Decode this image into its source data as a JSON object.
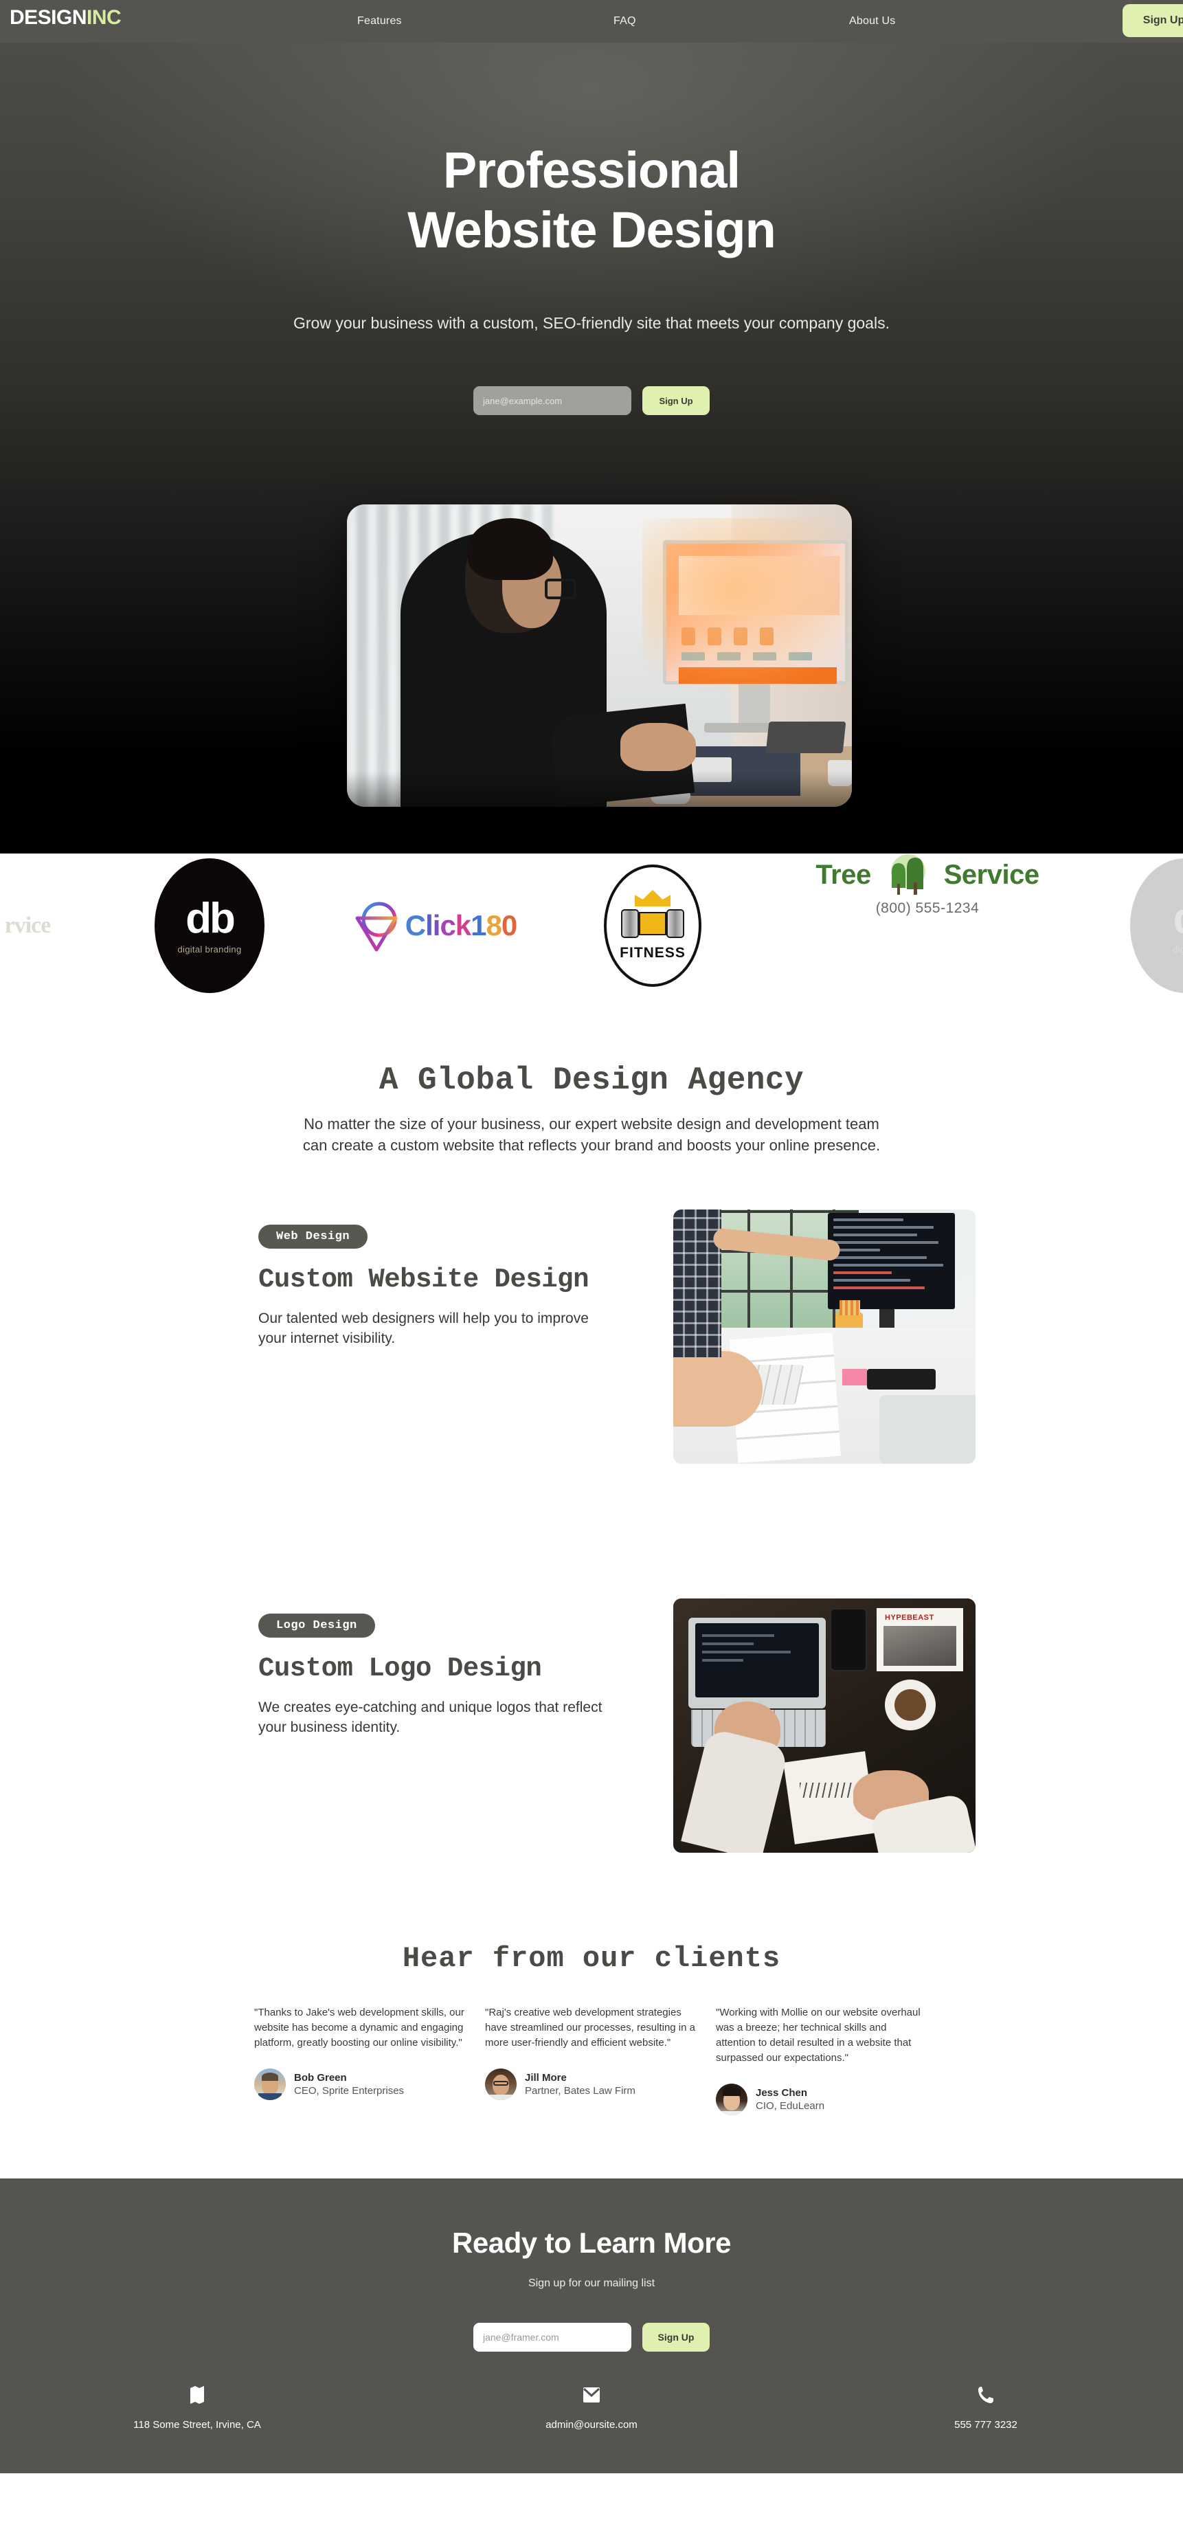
{
  "nav": {
    "logo_dark_text": "DESIGN",
    "logo_accent_text": "INC",
    "links": [
      {
        "label": "Features"
      },
      {
        "label": "FAQ"
      },
      {
        "label": "About Us"
      }
    ],
    "cta_label": "Sign Up",
    "accent_color": "#dff0b0",
    "bar_color": "#565450"
  },
  "hero": {
    "heading_line1": "Professional",
    "heading_line2": "Website Design",
    "subheading": "Grow your business with a custom, SEO-friendly site that meets your company goals.",
    "email_placeholder": "jane@example.com",
    "email_value": "",
    "cta_label": "Sign Up",
    "image_alt": "man-at-desk-using-computer-photo"
  },
  "logo_strip": {
    "items": [
      {
        "name": "partial-left-service-logo",
        "text": "rvice"
      },
      {
        "name": "db-digital-branding-logo",
        "main": "db",
        "sub": "digital branding"
      },
      {
        "name": "click180-logo",
        "word_parts": [
          {
            "t": "C",
            "c": "#4b7fd4"
          },
          {
            "t": "l",
            "c": "#5a5fc7"
          },
          {
            "t": "i",
            "c": "#7b4fc0"
          },
          {
            "t": "c",
            "c": "#a544b4"
          },
          {
            "t": "k",
            "c": "#d0408f"
          },
          {
            "t": "1",
            "c": "#3f74d0"
          },
          {
            "t": "8",
            "c": "#e8a33d"
          },
          {
            "t": "0",
            "c": "#e2643d"
          }
        ]
      },
      {
        "name": "fitness-logo",
        "word": "FITNESS"
      },
      {
        "name": "tree-service-logo",
        "word1": "Tree",
        "word2": "Service",
        "phone": "(800) 555-1234"
      },
      {
        "name": "partial-right-db-logo",
        "main": "d",
        "sub": "digital"
      }
    ]
  },
  "agency": {
    "heading": "A Global Design Agency",
    "body": "No matter the size of your business, our expert website design and development team can create a custom website that reflects your brand and boosts your online presence."
  },
  "features": [
    {
      "chip": "Web Design",
      "title": "Custom Website Design",
      "body": "Our talented web designers will help you to improve your internet visibility.",
      "image_alt": "designers-pointing-at-code-on-monitor-photo"
    },
    {
      "chip": "Logo Design",
      "title": "Custom Logo Design",
      "body": "We creates eye-catching and unique logos that reflect your business identity.",
      "image_alt": "overhead-desk-with-laptop-and-coffee-photo"
    }
  ],
  "testimonials": {
    "heading": "Hear from our clients",
    "cards": [
      {
        "quote": "\"Thanks to Jake's web development skills, our website has become a dynamic and engaging platform, greatly boosting our online visibility.\"",
        "name": "Bob Green",
        "role": "CEO, Sprite Enterprises",
        "avatar": "man-portrait-avatar"
      },
      {
        "quote": "\"Raj's creative web development strategies have streamlined our processes, resulting in a more user-friendly and efficient website.\"",
        "name": "Jill More",
        "role": "Partner, Bates Law Firm",
        "avatar": "woman-with-glasses-portrait-avatar"
      },
      {
        "quote": "\"Working with Mollie on our website overhaul was a breeze; her technical skills and attention to detail resulted in a website that surpassed our expectations.\"",
        "name": "Jess Chen",
        "role": "CIO, EduLearn",
        "avatar": "woman-portrait-avatar"
      }
    ]
  },
  "footer": {
    "heading": "Ready to Learn More",
    "subheading": "Sign up for our mailing list",
    "email_placeholder": "jane@framer.com",
    "email_value": "",
    "cta_label": "Sign Up",
    "contacts": [
      {
        "icon": "map-icon",
        "text": "118 Some Street, Irvine, CA"
      },
      {
        "icon": "mail-icon",
        "text": "admin@oursite.com"
      },
      {
        "icon": "phone-icon",
        "text": "555 777 3232"
      }
    ]
  }
}
